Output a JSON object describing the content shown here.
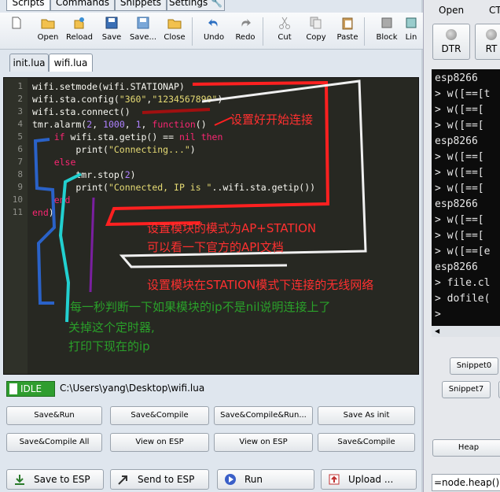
{
  "top_tabs": [
    "Scripts",
    "Commands",
    "Snippets",
    "Settings"
  ],
  "toolbar": {
    "new": "",
    "open": "Open",
    "reload": "Reload",
    "save": "Save",
    "save_as": "Save...",
    "close": "Close",
    "undo": "Undo",
    "redo": "Redo",
    "cut": "Cut",
    "copy": "Copy",
    "paste": "Paste",
    "block": "Block",
    "lin": "Lin"
  },
  "file_tabs": [
    "init.lua",
    "wifi.lua"
  ],
  "editor": {
    "line_numbers": [
      "1",
      "2",
      "3",
      "4",
      "5",
      "6",
      "7",
      "8",
      "9",
      "10",
      "11"
    ]
  },
  "annotations": {
    "a1": "设置好开始连接",
    "a2": "设置模块的模式为AP+STATION",
    "a3": "可以看一下官方的API文档",
    "a4": "设置模块在STATION模式下连接的无线网络",
    "a5": "每一秒判断一下如果模块的ip不是nil说明连接上了",
    "a6": "关掉这个定时器,",
    "a7": "打印下现在的ip"
  },
  "status": {
    "state": "IDLE",
    "path": "C:\\Users\\yang\\Desktop\\wifi.lua"
  },
  "buttons": {
    "save_run": "Save&Run",
    "save_compile": "Save&Compile",
    "save_compile_run": "Save&Compile&Run...",
    "save_as_init": "Save As init",
    "save_compile_all": "Save&Compile All",
    "view_on_esp_1": "View on ESP",
    "view_on_esp_2": "View on ESP",
    "save_compile_2": "Save&Compile",
    "save_to_esp": "Save to ESP",
    "send_to_esp": "Send to ESP",
    "run": "Run",
    "upload": "Upload ..."
  },
  "right_panel": {
    "open": "Open",
    "cts": "CT",
    "dtr": "DTR",
    "rts": "RT",
    "terminal": [
      "esp8266",
      "> w([==[t",
      "> w([==[",
      "> w([==[",
      "esp8266",
      "> w([==[",
      "> w([==[",
      "> w([==[",
      "esp8266",
      "> w([==[",
      "> w([==[",
      "> w([==[e",
      "esp8266",
      "> file.cl",
      "> dofile(",
      ">"
    ],
    "snippet0": "Snippet0",
    "snippet7": "Snippet7",
    "heap": "Heap",
    "cmd": "=node.heap()"
  },
  "colors": {
    "editor_bg": "#272822",
    "annotation_red": "#ff2020",
    "annotation_green": "#2aa02a",
    "idle_green": "#2f9d2f"
  }
}
